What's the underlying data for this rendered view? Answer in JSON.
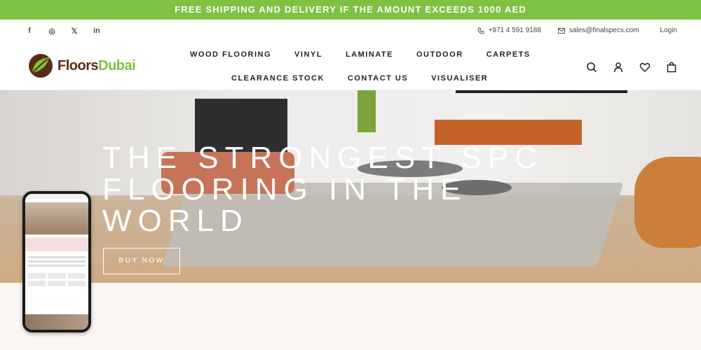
{
  "promo": {
    "text": "FREE SHIPPING AND DELIVERY IF THE AMOUNT EXCEEDS 1000 AED"
  },
  "topbar": {
    "social": [
      {
        "icon": "facebook-icon",
        "glyph": "f"
      },
      {
        "icon": "instagram-icon",
        "glyph": "◎"
      },
      {
        "icon": "x-twitter-icon",
        "glyph": "𝕏"
      },
      {
        "icon": "linkedin-icon",
        "glyph": "in"
      }
    ],
    "phone": "+971 4 591 9188",
    "email": "sales@finalspecs.com",
    "login": "Login"
  },
  "logo": {
    "part1": "Floors",
    "part2": "Dubai"
  },
  "nav": {
    "row1": [
      "WOOD FLOORING",
      "VINYL",
      "LAMINATE",
      "OUTDOOR",
      "CARPETS"
    ],
    "row2": [
      "CLEARANCE STOCK",
      "CONTACT US",
      "VISUALISER"
    ]
  },
  "hero": {
    "title": "THE STRONGEST SPC FLOORING IN THE WORLD",
    "cta": "BUY NOW"
  },
  "colors": {
    "brand_green": "#7dc242",
    "brand_brown": "#5a2b14"
  }
}
